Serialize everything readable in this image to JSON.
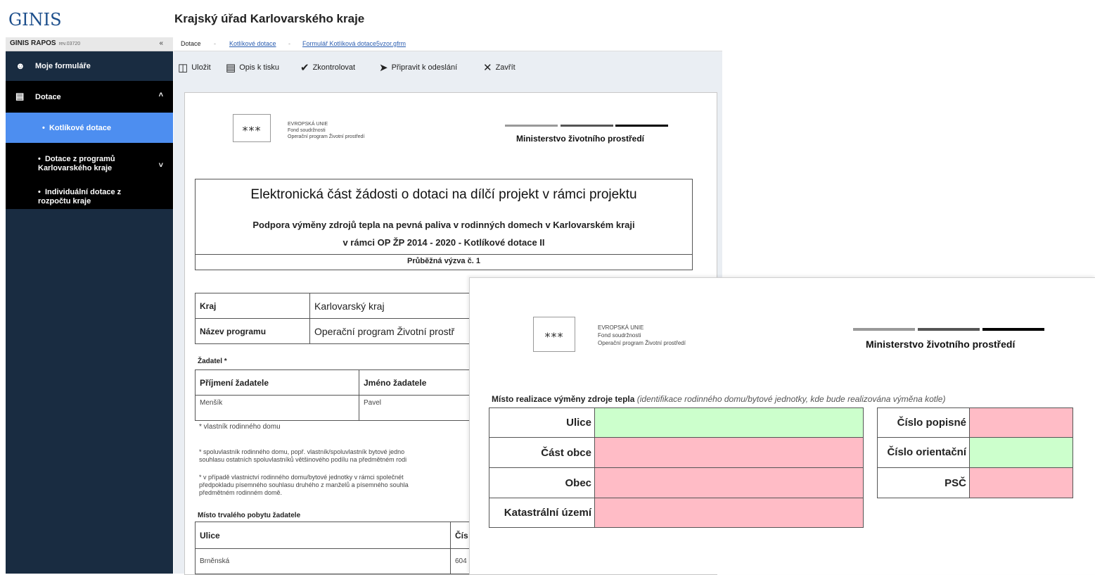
{
  "app": {
    "logo": "GINIS",
    "office_title": "Krajský úřad Karlovarského kraje"
  },
  "sidebar": {
    "app_name": "GINIS RAPOS",
    "revision": "rev.03720",
    "collapse_symbol": "«",
    "items": [
      {
        "label": "Moje formuláře",
        "icon": "user-icon"
      },
      {
        "label": "Dotace",
        "icon": "money-icon"
      },
      {
        "label": "Kotlíkové dotace"
      },
      {
        "label": "Dotace z programů Karlovarského kraje"
      },
      {
        "label": "Individuální dotace z rozpočtu kraje"
      }
    ]
  },
  "breadcrumb": {
    "items": [
      "Dotace",
      "Kotlíkové dotace",
      "Formulář Kotlíková dotace5vzor.gfrm"
    ],
    "separator": "-"
  },
  "toolbar": {
    "buttons": [
      {
        "label": "Uložit",
        "icon": "save-icon"
      },
      {
        "label": "Opis k tisku",
        "icon": "pdf-icon"
      },
      {
        "label": "Zkontrolovat",
        "icon": "check-icon"
      },
      {
        "label": "Připravit k odeslání",
        "icon": "send-icon"
      },
      {
        "label": "Zavřít",
        "icon": "close-icon"
      }
    ]
  },
  "form": {
    "eu_text": [
      "EVROPSKÁ UNIE",
      "Fond soudržnosti",
      "Operační program Životní prostředí"
    ],
    "ministry": "Ministerstvo životního prostředí",
    "title": "Elektronická část žádosti o dotaci na dílčí projekt v rámci projektu",
    "subtitle_1": "Podpora výměny zdrojů tepla na pevná paliva v rodinných domech v Karlovarském kraji",
    "subtitle_2": "v rámci OP ŽP 2014 - 2020 - Kotlíkové dotace II",
    "call": "Průběžná výzva č. 1",
    "kraj_label": "Kraj",
    "kraj_value": "Karlovarský kraj",
    "program_label": "Název programu",
    "program_value": "Operační program Životní prostř",
    "zadatel_label": "Žadatel *",
    "prijmeni_label": "Příjmení žadatele",
    "jmeno_label": "Jméno žadatele",
    "prijmeni_value": "Menšík",
    "jmeno_value": "Pavel",
    "note_owner": "*  vlastník rodinného domu",
    "note_coowner_1": "* spoluvlastník rodinného domu, popř. vlastník/spoluvlastník bytové jedno",
    "note_coowner_2": "souhlasu ostatních spoluvlastníků většinového podílu na předmětném rodi",
    "note_spouse_1": "* v případě vlastnictví rodinného domu/bytové jednotky v rámci společnét",
    "note_spouse_2": "předpokladu písemného souhlasu druhého z manželů a písemného souhla",
    "note_spouse_3": "předmětném rodinném domě.",
    "residence_label": "Místo trvalého pobytu žadatele",
    "ulice_label": "Ulice",
    "cis_label": "Čís",
    "ulice_value": "Brněnská",
    "cis_value": "604"
  },
  "overlay": {
    "eu_text": [
      "EVROPSKÁ UNIE",
      "Fond soudržnosti",
      "Operační program Životní prostředí"
    ],
    "ministry": "Ministerstvo životního prostředí",
    "heading_bold": "Místo realizace výměny zdroje tepla",
    "heading_italic": "(identifikace rodinného domu/bytové jednotky, kde bude realizována výměna kotle)",
    "left_fields": [
      {
        "label": "Ulice",
        "status": "green"
      },
      {
        "label": "Část obce",
        "status": "pink"
      },
      {
        "label": "Obec",
        "status": "pink"
      },
      {
        "label": "Katastrální území",
        "status": "pink"
      }
    ],
    "right_fields": [
      {
        "label": "Číslo popisné",
        "status": "pink"
      },
      {
        "label": "Číslo orientační",
        "status": "green"
      },
      {
        "label": "PSČ",
        "status": "pink"
      }
    ]
  },
  "colors": {
    "sidebar": "#192c41",
    "active": "#4d8ef0",
    "valid": "#ccffcc",
    "invalid": "#ffbcc6"
  }
}
